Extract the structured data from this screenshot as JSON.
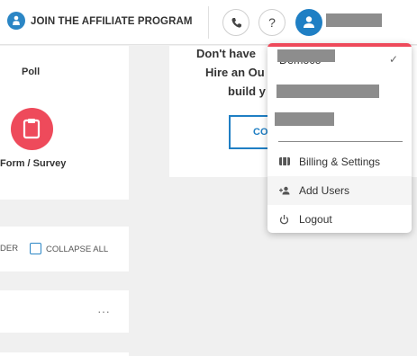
{
  "topbar": {
    "affiliate_label": "JOIN THE AFFILIATE PROGRAM",
    "help_label": "?"
  },
  "left": {
    "poll_label": "Poll",
    "form_label": "Form / Survey",
    "order_label": "DER",
    "collapse_label": "COLLAPSE ALL",
    "more_label": "···"
  },
  "center": {
    "line1": "Don't have",
    "line2": "Hire an Ou",
    "line3": "build y",
    "button_label": "CO"
  },
  "dropdown": {
    "current_account": "Democo",
    "check": "✓",
    "items": [
      {
        "label": "Billing & Settings",
        "icon": "wallet-icon"
      },
      {
        "label": "Add Users",
        "icon": "add-user-icon"
      },
      {
        "label": "Logout",
        "icon": "power-icon"
      }
    ]
  },
  "colors": {
    "accent_blue": "#1f7fc4",
    "accent_red": "#ee4a5b",
    "redaction": "#8d8d8d"
  }
}
